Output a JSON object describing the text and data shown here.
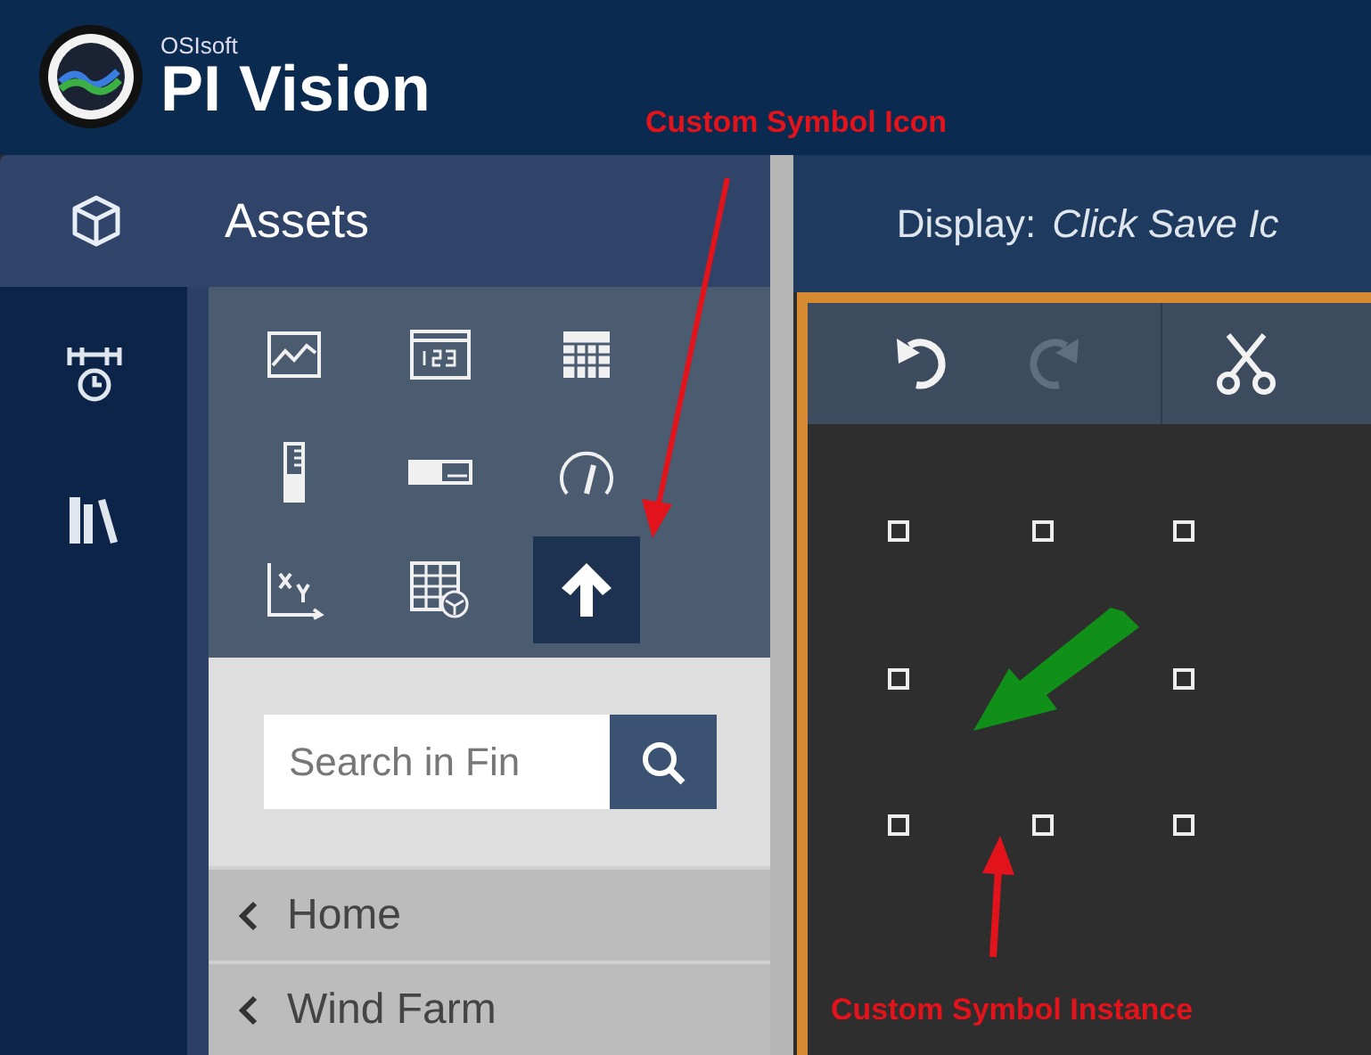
{
  "app": {
    "vendor": "OSIsoft",
    "title": "PI Vision"
  },
  "nav": {
    "section": "Assets"
  },
  "symbol_palette": [
    {
      "kind": "trend",
      "selected": false
    },
    {
      "kind": "value",
      "selected": false
    },
    {
      "kind": "table",
      "selected": false
    },
    {
      "kind": "vertical-gauge",
      "selected": false
    },
    {
      "kind": "horizontal-gauge",
      "selected": false
    },
    {
      "kind": "radial-gauge",
      "selected": false
    },
    {
      "kind": "xy-plot",
      "selected": false
    },
    {
      "kind": "asset-table",
      "selected": false
    },
    {
      "kind": "custom-symbol",
      "selected": true
    }
  ],
  "search": {
    "placeholder": "Search in Fin"
  },
  "breadcrumbs": [
    "Home",
    "Wind Farm"
  ],
  "display": {
    "label": "Display:",
    "name": "Click Save Ic"
  },
  "toolbar": [
    {
      "kind": "undo",
      "disabled": false
    },
    {
      "kind": "redo",
      "disabled": true
    },
    {
      "kind": "cut",
      "disabled": false
    }
  ],
  "canvas": {
    "symbol": {
      "selected": true
    }
  },
  "annotations": [
    {
      "kind": "icon-callout",
      "text": "Custom Symbol Icon"
    },
    {
      "kind": "instance-callout",
      "text": "Custom Symbol Instance"
    }
  ]
}
